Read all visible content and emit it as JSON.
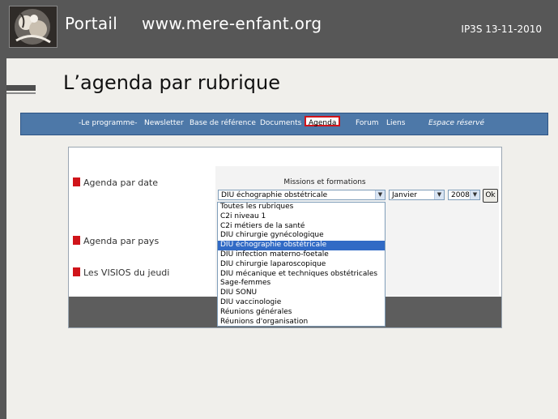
{
  "header": {
    "portal_label": "Portail",
    "site_url": "www.mere-enfant.org",
    "event_date": "IP3S 13-11-2010"
  },
  "slide": {
    "title": "L’agenda par rubrique"
  },
  "nav": {
    "items": [
      {
        "label": "-Le programme-"
      },
      {
        "label": "Newsletter"
      },
      {
        "label": "Base de référence"
      },
      {
        "label": "Documents"
      },
      {
        "label": "Agenda",
        "selected": true
      },
      {
        "label": "Forum"
      },
      {
        "label": "Liens"
      },
      {
        "label": "Espace réservé"
      }
    ]
  },
  "agenda": {
    "rows": [
      {
        "label": "Agenda par date"
      },
      {
        "label": "Agenda par pays"
      },
      {
        "label": "Les VISIOS du jeudi"
      }
    ],
    "form_title": "Missions et formations",
    "rubrique_value": "DIU échographie obstétricale",
    "month_value": "Janvier",
    "year_value": "2008",
    "ok_label": "Ok",
    "options": [
      "Toutes les rubriques",
      "C2i niveau 1",
      "C2i métiers de la santé",
      "DIU chirurgie gynécologique",
      "DIU échographie obstétricale",
      "DIU infection materno-foetale",
      "DIU chirurgie laparoscopique",
      "DIU mécanique et techniques obstétricales",
      "Sage-femmes",
      "DIU SONU",
      "DIU vaccinologie",
      "Réunions générales",
      "Réunions d'organisation"
    ],
    "selected_option": "DIU échographie obstétricale"
  },
  "colors": {
    "header_bg": "#575757",
    "nav_bg": "#4d78a8",
    "accent_red": "#d0141a",
    "selection_blue": "#316ac5"
  }
}
